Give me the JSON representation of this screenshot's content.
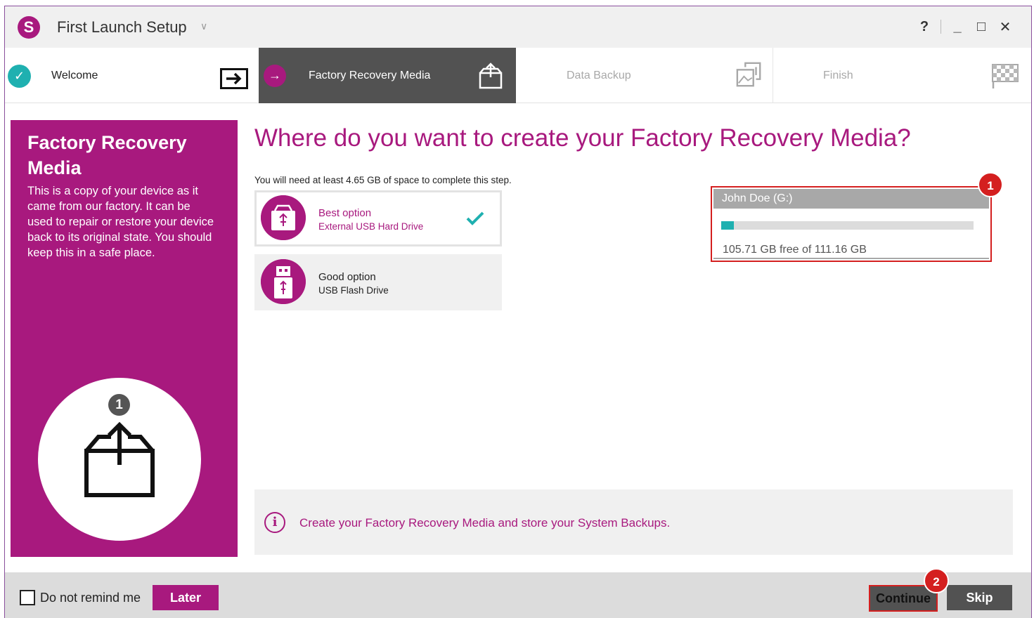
{
  "window": {
    "title": "First Launch Setup",
    "controls": {
      "help": "?",
      "minimize": "_",
      "maximize": "□",
      "close": "✕"
    }
  },
  "steps": [
    {
      "label": "Welcome",
      "state": "done",
      "icon": "arrow-right-box-icon"
    },
    {
      "label": "Factory Recovery Media",
      "state": "active",
      "icon": "export-box-icon"
    },
    {
      "label": "Data Backup",
      "state": "pending",
      "icon": "image-backup-icon"
    },
    {
      "label": "Finish",
      "state": "pending",
      "icon": "checkered-flag-icon"
    }
  ],
  "sidebar": {
    "title": "Factory Recovery Media",
    "description": "This is a copy of your device as it came from our factory. It can be used to repair or restore your device back to its original state. You should keep this in a safe place.",
    "step_number": "1"
  },
  "main": {
    "heading": "Where do you want to create your Factory Recovery Media?",
    "space_note": "You will need at least 4.65 GB of space to complete this step.",
    "options": [
      {
        "title": "Best option",
        "subtitle": "External USB Hard Drive",
        "selected": true
      },
      {
        "title": "Good option",
        "subtitle": "USB Flash Drive",
        "selected": false
      }
    ],
    "drive": {
      "name": "John Doe (G:)",
      "free_text": "105.71 GB free of 111.16 GB",
      "used_fraction": 0.049
    },
    "info": "Create your Factory Recovery Media and store your System Backups."
  },
  "badges": {
    "drive": "1",
    "continue": "2"
  },
  "footer": {
    "remind_label": "Do not remind me",
    "later": "Later",
    "continue": "Continue",
    "skip": "Skip"
  },
  "colors": {
    "brand": "#a8197e",
    "teal": "#1fb0b0",
    "dark": "#525252",
    "highlight": "#d41f1f"
  }
}
